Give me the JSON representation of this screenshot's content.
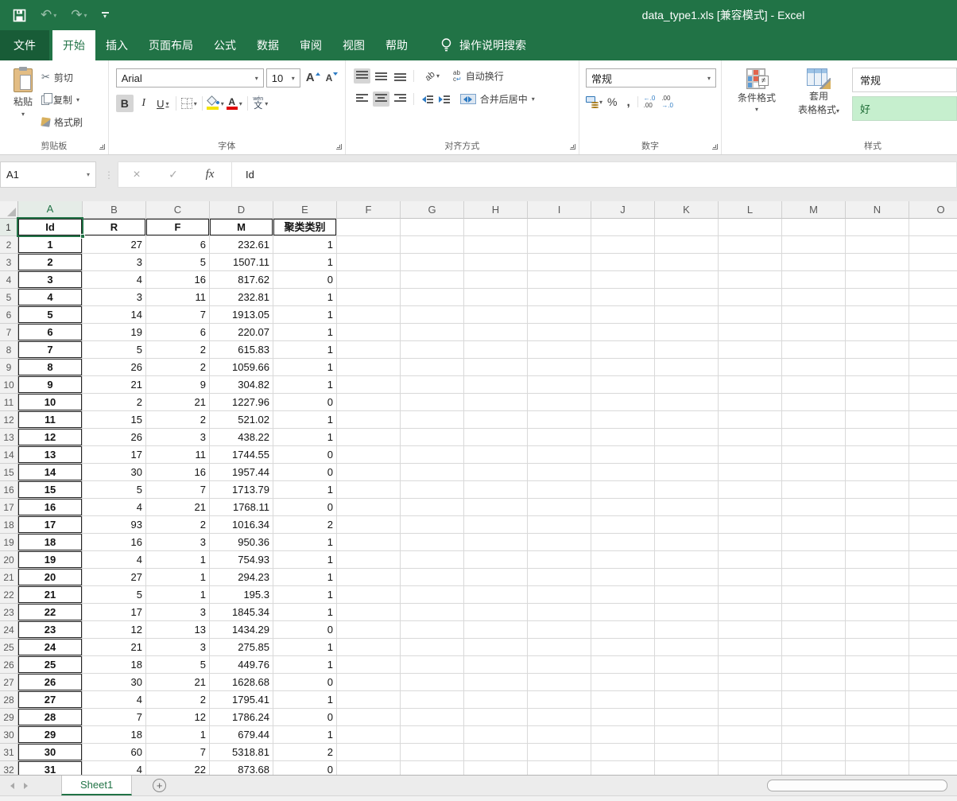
{
  "window": {
    "title": "data_type1.xls  [兼容模式] - Excel"
  },
  "tabs": {
    "file": "文件",
    "items": [
      "开始",
      "插入",
      "页面布局",
      "公式",
      "数据",
      "审阅",
      "视图",
      "帮助"
    ],
    "active": "开始",
    "search_label": "操作说明搜索"
  },
  "ribbon": {
    "clipboard": {
      "label": "剪贴板",
      "paste": "粘贴",
      "cut": "剪切",
      "copy": "复制",
      "format_painter": "格式刷"
    },
    "font": {
      "label": "字体",
      "font_name": "Arial",
      "font_size": "10",
      "bold": "B",
      "italic": "I",
      "underline": "U",
      "grow_letter": "A",
      "shrink_letter": "A",
      "color_letter": "A",
      "phonetic_top": "wén",
      "phonetic_bottom": "文"
    },
    "alignment": {
      "label": "对齐方式",
      "orientation_ab": "ab",
      "wrap_text": "自动换行",
      "wrap_ab": "ab",
      "wrap_c": "c",
      "wrap_arrow": "↵",
      "merge_center": "合并后居中"
    },
    "number": {
      "label": "数字",
      "format": "常规",
      "percent": "%",
      "comma": ",",
      "inc_dec_top": "←.0",
      "inc_dec_bottom": ".00",
      "dec_dec_top": ".00",
      "dec_dec_bottom": "→.0"
    },
    "styles": {
      "label": "样式",
      "conditional": "条件格式",
      "format_table_1": "套用",
      "format_table_2": "表格格式",
      "neq": "≠",
      "style_normal": "常规",
      "style_good": "好"
    }
  },
  "formula_bar": {
    "name_box": "A1",
    "cancel": "×",
    "enter": "✓",
    "fx": "fx",
    "value": "Id"
  },
  "glyphs": {
    "dd": "▾",
    "scissors": "✂",
    "undo": "↶",
    "redo": "↷",
    "dots": "⋮",
    "add_sheet": "+"
  },
  "sheet": {
    "columns": [
      "A",
      "B",
      "C",
      "D",
      "E",
      "F",
      "G",
      "H",
      "I",
      "J",
      "K",
      "L",
      "M",
      "N",
      "O"
    ],
    "selected_cell": "A1",
    "selected_column": "A",
    "selected_row": 1,
    "visible_rows": 32,
    "header_row": [
      "Id",
      "R",
      "F",
      "M",
      "聚类类别"
    ],
    "rows": [
      [
        1,
        27,
        6,
        "232.61",
        1
      ],
      [
        2,
        3,
        5,
        "1507.11",
        1
      ],
      [
        3,
        4,
        16,
        "817.62",
        0
      ],
      [
        4,
        3,
        11,
        "232.81",
        1
      ],
      [
        5,
        14,
        7,
        "1913.05",
        1
      ],
      [
        6,
        19,
        6,
        "220.07",
        1
      ],
      [
        7,
        5,
        2,
        "615.83",
        1
      ],
      [
        8,
        26,
        2,
        "1059.66",
        1
      ],
      [
        9,
        21,
        9,
        "304.82",
        1
      ],
      [
        10,
        2,
        21,
        "1227.96",
        0
      ],
      [
        11,
        15,
        2,
        "521.02",
        1
      ],
      [
        12,
        26,
        3,
        "438.22",
        1
      ],
      [
        13,
        17,
        11,
        "1744.55",
        0
      ],
      [
        14,
        30,
        16,
        "1957.44",
        0
      ],
      [
        15,
        5,
        7,
        "1713.79",
        1
      ],
      [
        16,
        4,
        21,
        "1768.11",
        0
      ],
      [
        17,
        93,
        2,
        "1016.34",
        2
      ],
      [
        18,
        16,
        3,
        "950.36",
        1
      ],
      [
        19,
        4,
        1,
        "754.93",
        1
      ],
      [
        20,
        27,
        1,
        "294.23",
        1
      ],
      [
        21,
        5,
        1,
        "195.3",
        1
      ],
      [
        22,
        17,
        3,
        "1845.34",
        1
      ],
      [
        23,
        12,
        13,
        "1434.29",
        0
      ],
      [
        24,
        21,
        3,
        "275.85",
        1
      ],
      [
        25,
        18,
        5,
        "449.76",
        1
      ],
      [
        26,
        30,
        21,
        "1628.68",
        0
      ],
      [
        27,
        4,
        2,
        "1795.41",
        1
      ],
      [
        28,
        7,
        12,
        "1786.24",
        0
      ],
      [
        29,
        18,
        1,
        "679.44",
        1
      ],
      [
        30,
        60,
        7,
        "5318.81",
        2
      ],
      [
        31,
        4,
        22,
        "873.68",
        0
      ]
    ]
  },
  "sheet_tabs": {
    "active": "Sheet1"
  },
  "colors": {
    "accent_green": "#217346",
    "file_tab_green": "#185c37",
    "good_style_bg": "#C6EFCE",
    "good_style_text": "#1d6b35",
    "fill_yellow": "#f3e400",
    "font_color_red": "#e00000"
  }
}
